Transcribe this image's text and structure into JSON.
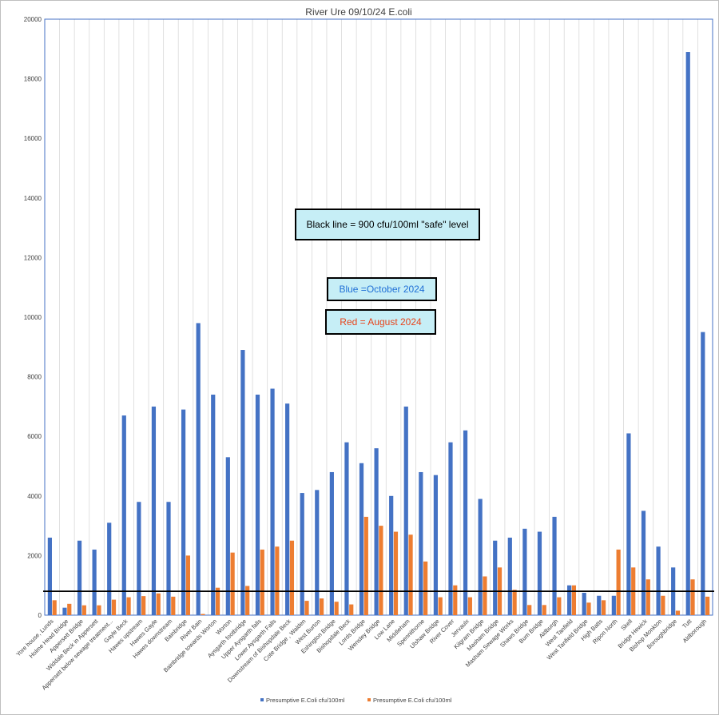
{
  "chart_data": {
    "type": "bar",
    "title": "River Ure 09/10/24 E.coli",
    "xlabel": "",
    "ylabel": "",
    "ylim": [
      0,
      20000
    ],
    "yticks": [
      0,
      2000,
      4000,
      6000,
      8000,
      10000,
      12000,
      14000,
      16000,
      18000,
      20000
    ],
    "grid": true,
    "legend_position": "bottom",
    "categories": [
      "Yore house, Lunds",
      "Holme Head Bridge",
      "Appersett Bridge",
      "Widdale Beck in Appersett",
      "Appersett below sewage treatment...",
      "Gayle Beck",
      "Hawes upstream",
      "Hawes  Gayle",
      "Hawes downstream",
      "Bainbridge",
      "River Bain",
      "Bainbridge towards Worton",
      "Worton",
      "Aysgarth footbridge",
      "Upper Aysgarth falls",
      "Lower Aysgarth Falls",
      "Downstream of Bishopdale Beck",
      "Cote Bridge , Walden",
      "West Burton",
      "Eshington Bridge",
      "Bishopdale Beck",
      "Lords Bridge",
      "Wensley Bridge",
      "Low Lane",
      "Middleham",
      "Spennithorne",
      "Ulshaw Bridge",
      "River Cover",
      "Jervaulx",
      "Kilgram  Bridge",
      "Masham Bridge",
      "Masham Sewage Works",
      "Shaws Bridge",
      "Bum Bridge",
      "Aldburgh",
      "West Tanfield",
      "West Tanfield Bridge",
      "High Batts",
      "Ripon North",
      "Skell",
      "Bridge Hewick",
      "Bishop Monkton",
      "Boroughbridge",
      "Tutt",
      "Aldborough"
    ],
    "series": [
      {
        "name": "Presumptive E.Coli cfu/100ml",
        "color": "#4472c4",
        "values": [
          2600,
          250,
          2500,
          2200,
          3100,
          6700,
          3800,
          7000,
          3800,
          6900,
          9800,
          7400,
          5300,
          8900,
          7400,
          7600,
          7100,
          4100,
          4200,
          4800,
          5800,
          5100,
          5600,
          4000,
          7000,
          4800,
          4700,
          5800,
          6200,
          3900,
          2500,
          2600,
          2900,
          2800,
          3300,
          1000,
          750,
          650,
          650,
          6100,
          3500,
          2300,
          1600,
          18900,
          9500
        ]
      },
      {
        "name": "Presumptive E.Coli cfu/100ml",
        "color": "#ed7d31",
        "values": [
          500,
          380,
          330,
          330,
          520,
          600,
          640,
          730,
          620,
          2000,
          40,
          920,
          2100,
          980,
          2200,
          2300,
          2500,
          480,
          560,
          450,
          360,
          3300,
          3000,
          2800,
          2700,
          1800,
          600,
          1000,
          600,
          1300,
          1600,
          850,
          340,
          340,
          600,
          1000,
          420,
          500,
          2200,
          1600,
          1200,
          650,
          150,
          1200,
          620
        ]
      }
    ],
    "reference_line": {
      "value": 800,
      "color": "#000000"
    },
    "annotations": [
      {
        "text": "Black line = 900 cfu/100ml \"safe\" level",
        "color": "#000000"
      },
      {
        "text": "Blue =October 2024",
        "color": "#1f6fd6"
      },
      {
        "text": "Red = August 2024",
        "color": "#e8431a"
      }
    ]
  }
}
